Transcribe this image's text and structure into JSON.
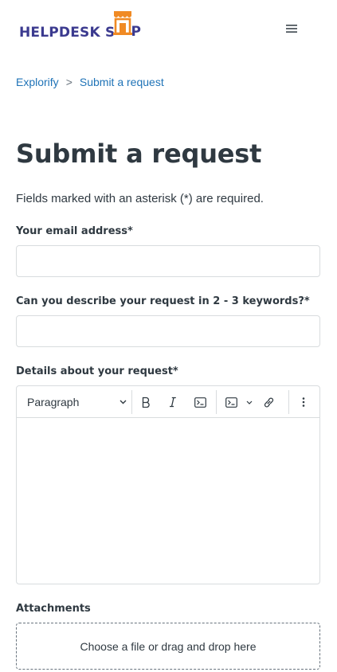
{
  "header": {
    "logo_text_left": "HELPDESK S",
    "logo_text_right": "P",
    "menu_icon": "hamburger-menu-icon"
  },
  "breadcrumb": {
    "items": [
      "Explorify",
      "Submit a request"
    ],
    "separator": ">"
  },
  "page": {
    "title": "Submit a request",
    "required_note": "Fields marked with an asterisk (*) are required."
  },
  "form": {
    "email_label": "Your email address*",
    "email_value": "",
    "keywords_label": "Can you describe your request in 2 - 3 keywords?*",
    "keywords_value": "",
    "details_label": "Details about your request*",
    "toolbar": {
      "paragraph_select": "Paragraph",
      "icons": [
        "bold-icon",
        "italic-icon",
        "code-icon",
        "code-block-icon",
        "link-icon",
        "more-options-icon"
      ]
    },
    "attachments_label": "Attachments",
    "dropzone_text": "Choose a file or drag and drop here"
  },
  "colors": {
    "link": "#1f73b7",
    "text": "#2f3941",
    "logo_blue": "#3b3a8f",
    "logo_orange": "#f08a24",
    "border": "#d8dcde"
  }
}
